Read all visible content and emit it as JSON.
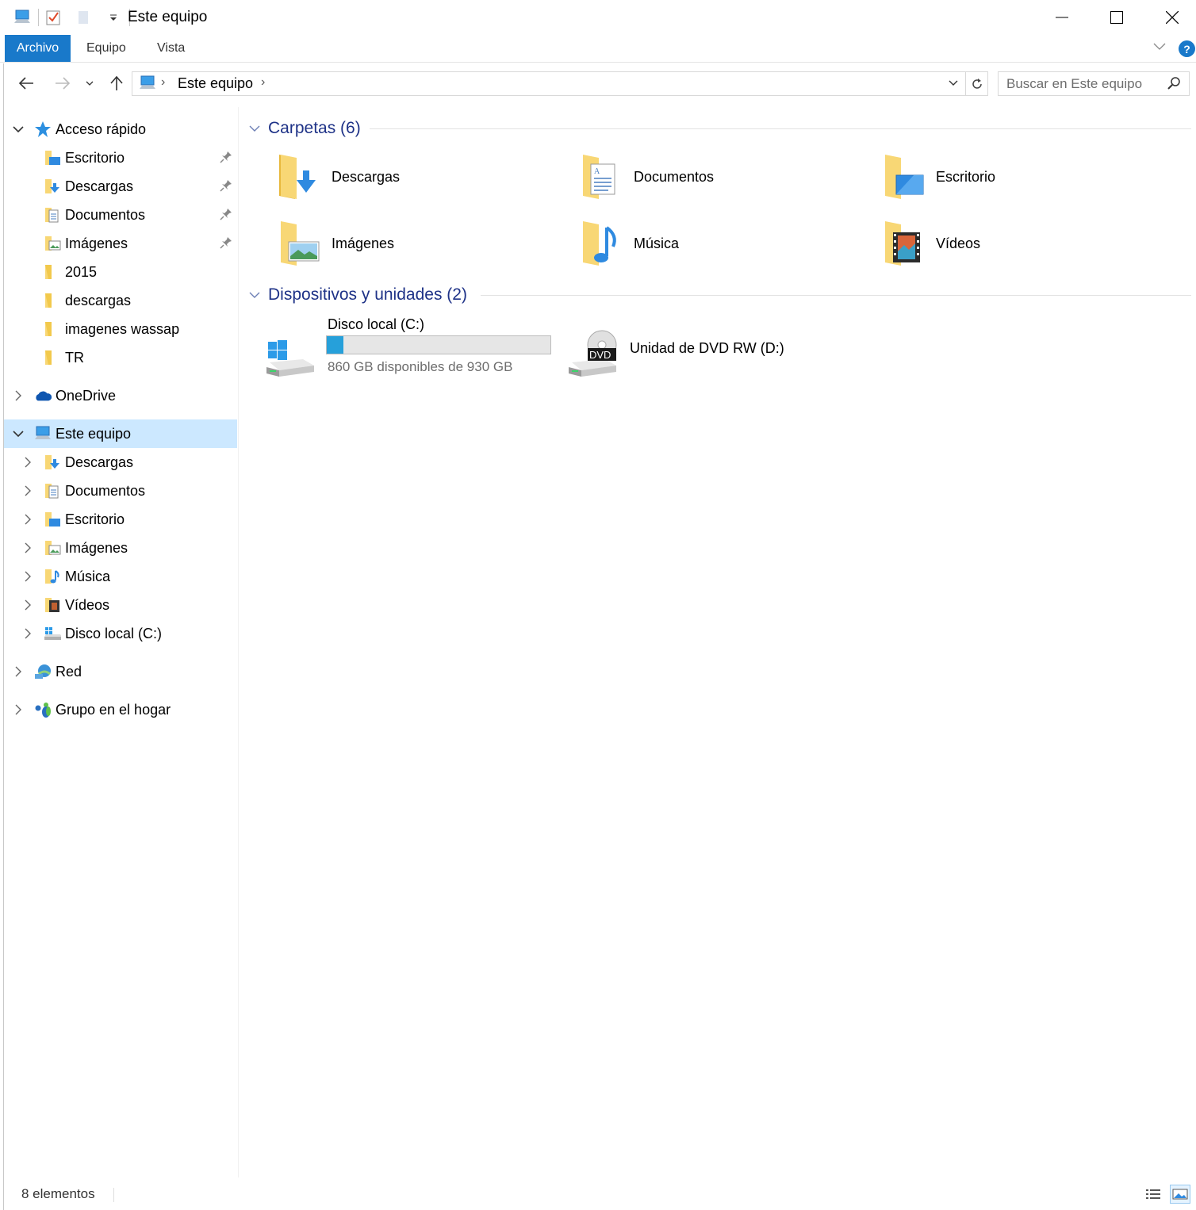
{
  "window": {
    "title": "Este equipo"
  },
  "ribbon": {
    "tabs": [
      {
        "label": "Archivo",
        "active": true
      },
      {
        "label": "Equipo"
      },
      {
        "label": "Vista"
      }
    ],
    "help_label": "?"
  },
  "address": {
    "path": "Este equipo",
    "separator": "›",
    "search_placeholder": "Buscar en Este equipo"
  },
  "nav_pane": {
    "quick_access": {
      "label": "Acceso rápido",
      "items": [
        {
          "label": "Escritorio",
          "icon": "desktop-folder-icon",
          "pinned": true
        },
        {
          "label": "Descargas",
          "icon": "downloads-folder-icon",
          "pinned": true
        },
        {
          "label": "Documentos",
          "icon": "documents-folder-icon",
          "pinned": true
        },
        {
          "label": "Imágenes",
          "icon": "pictures-folder-icon",
          "pinned": true
        },
        {
          "label": "2015",
          "icon": "folder-icon"
        },
        {
          "label": "descargas",
          "icon": "folder-icon"
        },
        {
          "label": "imagenes wassap",
          "icon": "folder-icon"
        },
        {
          "label": "TR",
          "icon": "folder-icon"
        }
      ]
    },
    "onedrive": {
      "label": "OneDrive"
    },
    "this_pc": {
      "label": "Este equipo",
      "selected": true,
      "items": [
        {
          "label": "Descargas"
        },
        {
          "label": "Documentos"
        },
        {
          "label": "Escritorio"
        },
        {
          "label": "Imágenes"
        },
        {
          "label": "Música"
        },
        {
          "label": "Vídeos"
        },
        {
          "label": "Disco local (C:)"
        }
      ]
    },
    "network": {
      "label": "Red"
    },
    "homegroup": {
      "label": "Grupo en el hogar"
    }
  },
  "content": {
    "folders_group": {
      "title": "Carpetas (6)",
      "items": [
        {
          "label": "Descargas",
          "icon": "downloads-folder-icon"
        },
        {
          "label": "Documentos",
          "icon": "documents-folder-icon"
        },
        {
          "label": "Escritorio",
          "icon": "desktop-folder-icon"
        },
        {
          "label": "Imágenes",
          "icon": "pictures-folder-icon"
        },
        {
          "label": "Música",
          "icon": "music-folder-icon"
        },
        {
          "label": "Vídeos",
          "icon": "videos-folder-icon"
        }
      ]
    },
    "devices_group": {
      "title": "Dispositivos y unidades (2)",
      "drives": [
        {
          "label": "Disco local (C:)",
          "free_text": "860 GB disponibles de 930 GB",
          "used_fraction": 0.075
        },
        {
          "label": "Unidad de DVD RW (D:)",
          "badge": "DVD"
        }
      ]
    }
  },
  "status_bar": {
    "count_text": "8 elementos"
  },
  "colors": {
    "accent": "#1979ca",
    "selection": "#cce8ff",
    "group_title": "#1e3287",
    "drive_fill": "#26a0da",
    "folder_yellow": "#f8d775"
  }
}
